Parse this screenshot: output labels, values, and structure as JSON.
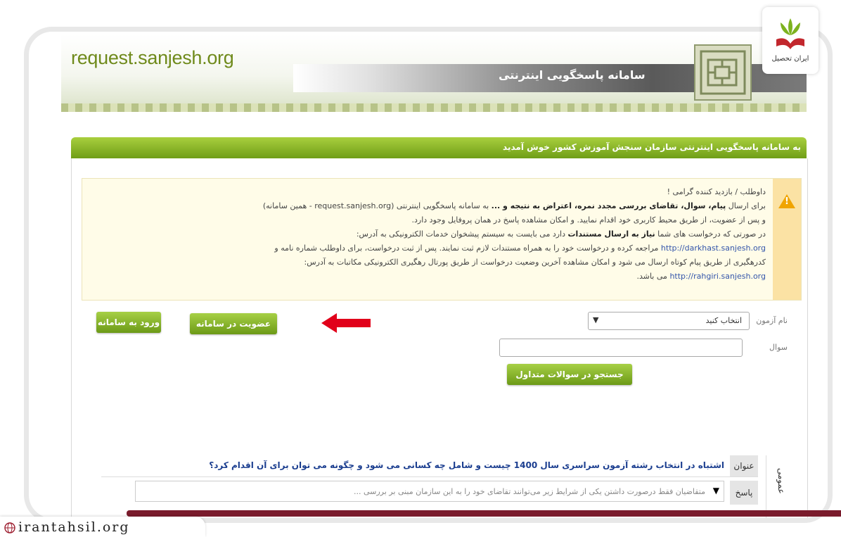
{
  "header": {
    "url": "request.sanjesh.org",
    "title": "سامانه پاسخگویی اینترنتی"
  },
  "welcome": "به سامانه پاسخگویی اینترنتی سازمان سنجش آموزش کشور خوش آمدید",
  "notice": {
    "greeting": "داوطلب / بازدید کننده گرامی !",
    "line1a": "برای ارسال",
    "line1b": "پیام، سوال، تقاضای بررسی مجدد نمره، اعتراض به نتیجه و ...",
    "line1c": "به سامانه پاسخگویی اینترنتی (request.sanjesh.org - همین سامانه)",
    "line2": "و پس از عضویت، از طریق محیط کاربری خود اقدام نمایید. و امکان مشاهده پاسخ در همان پروفایل وجود دارد.",
    "line3a": "در صورتی که درخواست های شما",
    "line3b": "نیاز به ارسال مستندات",
    "line3c": "دارد می بایست به سیستم پیشخوان خدمات الکترونیکی به آدرس:",
    "line4_link": "http://darkhast.sanjesh.org",
    "line4": "مراجعه کرده و درخواست خود را به همراه مستندات لازم ثبت نمایند. پس از ثبت درخواست، برای داوطلب شماره نامه و",
    "line5": "کدرهگیری از طریق پیام کوتاه ارسال می شود و امکان مشاهده آخرین وضعیت درخواست از طریق پورتال رهگیری الکترونیکی مکاتبات به آدرس:",
    "line6_link": "http://rahgiri.sanjesh.org",
    "line6": "می باشد."
  },
  "buttons": {
    "login": "ورود به سامانه",
    "register": "عضویت در سامانه",
    "search": "جستجو در سوالات متداول"
  },
  "form": {
    "exam_label": "نام آزمون",
    "exam_value": "انتخاب کنید",
    "question_label": "سوال",
    "question_value": ""
  },
  "faq": {
    "category": "عمومی",
    "title_label": "عنوان",
    "title": "اشتباه در انتخاب رشته آزمون سراسری سال 1400 چیست و شامل چه کسانی می شود و چگونه می توان برای آن اقدام کرد؟",
    "answer_label": "پاسخ",
    "answer": "متقاضیان فقط درصورت داشتن یکی از شرایط زیر می‌توانند تقاضای خود را به این سازمان مبنی بر بررسی ..."
  },
  "watermark": "irantahsil.org",
  "brand": "ایران تحصیل",
  "colors": {
    "accent_green": "#8bbd2a",
    "url_green": "#6f8a1b",
    "arrow_red": "#e1001a",
    "notice_bg": "#fffce8",
    "warn_bg": "#fbe2a4",
    "link_blue": "#3355aa",
    "faq_title": "#1a3d8f"
  },
  "icons": [
    "warning-icon",
    "arrow-icon",
    "globe-icon",
    "dropdown-icon",
    "expand-icon"
  ]
}
